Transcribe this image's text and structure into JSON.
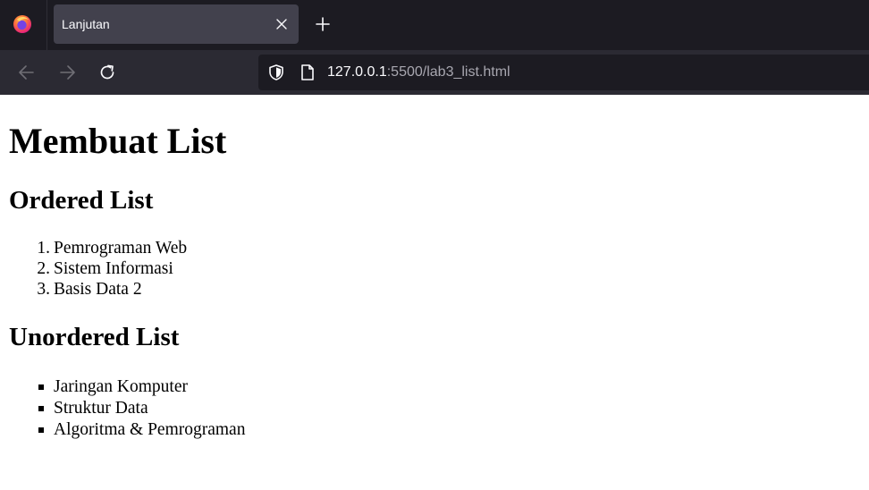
{
  "browser": {
    "tab": {
      "title": "Lanjutan"
    },
    "url": {
      "host": "127.0.0.1",
      "rest": ":5500/lab3_list.html"
    },
    "icons": [
      "firefox-icon",
      "close-icon",
      "plus-icon",
      "back-arrow-icon",
      "forward-arrow-icon",
      "reload-icon",
      "shield-icon",
      "page-icon"
    ],
    "colors": {
      "tabbar": "#1c1b22",
      "active_tab": "#42414d",
      "navbar": "#2b2a33",
      "urlbar": "#1c1b22"
    }
  },
  "page": {
    "title": "Membuat List",
    "ordered": {
      "heading": "Ordered List",
      "items": [
        {
          "marker": "1.",
          "text": "Pemrograman Web"
        },
        {
          "marker": "2.",
          "text": "Sistem Informasi"
        },
        {
          "marker": "3.",
          "text": "Basis Data 2"
        }
      ]
    },
    "unordered": {
      "heading": "Unordered List",
      "items": [
        {
          "text": "Jaringan Komputer"
        },
        {
          "text": "Struktur Data"
        },
        {
          "text": "Algoritma & Pemrograman"
        }
      ]
    }
  }
}
